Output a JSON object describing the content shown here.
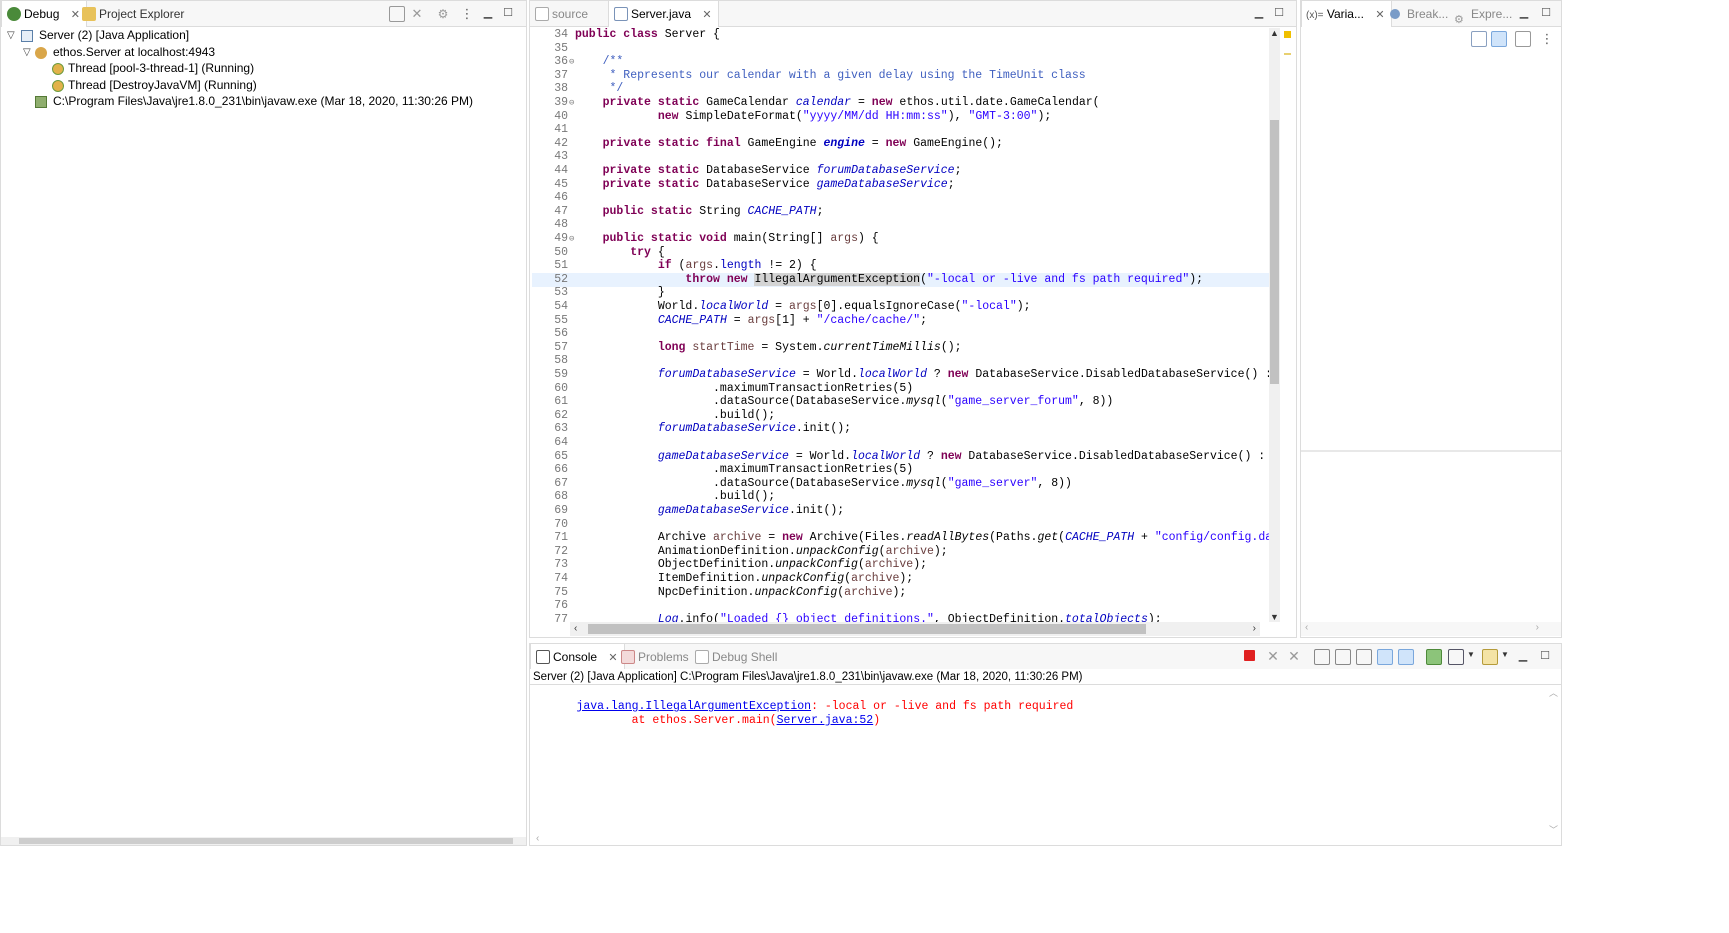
{
  "debug_panel": {
    "tabs": [
      {
        "label": "Debug",
        "active": true,
        "closable": true
      },
      {
        "label": "Project Explorer",
        "active": false,
        "closable": false
      }
    ],
    "tree": [
      {
        "label": "Server (2) [Java Application]",
        "depth": 0,
        "expanded": true,
        "icon": "java-app-icon"
      },
      {
        "label": "ethos.Server at localhost:4943",
        "depth": 1,
        "expanded": true,
        "icon": "vm-icon"
      },
      {
        "label": "Thread [pool-3-thread-1] (Running)",
        "depth": 2,
        "icon": "thread-icon"
      },
      {
        "label": "Thread [DestroyJavaVM] (Running)",
        "depth": 2,
        "icon": "thread-icon"
      },
      {
        "label": "C:\\Program Files\\Java\\jre1.8.0_231\\bin\\javaw.exe (Mar 18, 2020, 11:30:26 PM)",
        "depth": 1,
        "icon": "process-icon"
      }
    ]
  },
  "editor": {
    "tabs": [
      {
        "label": "source",
        "active": false
      },
      {
        "label": "Server.java",
        "active": true,
        "closable": true
      }
    ],
    "highlighted_line": 52,
    "lines": [
      {
        "n": "34",
        "fold": "",
        "html": "<span class=\"kw\">public class</span> Server {"
      },
      {
        "n": "35",
        "fold": "",
        "html": ""
      },
      {
        "n": "36",
        "fold": "⊖",
        "html": "    <span class=\"cm\">/**</span>"
      },
      {
        "n": "37",
        "fold": "",
        "html": "<span class=\"cm\">     * Represents our calendar with a given delay using the TimeUnit class</span>"
      },
      {
        "n": "38",
        "fold": "",
        "html": "<span class=\"cm\">     */</span>"
      },
      {
        "n": "39",
        "fold": "⊖",
        "html": "    <span class=\"kw\">private static</span> GameCalendar <span class=\"fld\">calendar</span> = <span class=\"kw\">new</span> ethos.util.date.GameCalendar("
      },
      {
        "n": "40",
        "fold": "",
        "html": "            <span class=\"kw\">new</span> SimpleDateFormat(<span class=\"str\">\"yyyy/MM/dd HH:mm:ss\"</span>), <span class=\"str\">\"GMT-3:00\"</span>);"
      },
      {
        "n": "41",
        "fold": "",
        "html": ""
      },
      {
        "n": "42",
        "fold": "",
        "html": "    <span class=\"kw\">private static final</span> GameEngine <span class=\"fld\" style=\"font-weight:bold\">engine</span> = <span class=\"kw\">new</span> GameEngine();"
      },
      {
        "n": "43",
        "fold": "",
        "html": ""
      },
      {
        "n": "44",
        "fold": "",
        "html": "    <span class=\"kw\">private static</span> DatabaseService <span class=\"fld\">forumDatabaseService</span>;"
      },
      {
        "n": "45",
        "fold": "",
        "html": "    <span class=\"kw\">private static</span> DatabaseService <span class=\"fld\">gameDatabaseService</span>;"
      },
      {
        "n": "46",
        "fold": "",
        "html": ""
      },
      {
        "n": "47",
        "fold": "",
        "html": "    <span class=\"kw\">public static</span> String <span class=\"fld\">CACHE_PATH</span>;"
      },
      {
        "n": "48",
        "fold": "",
        "html": ""
      },
      {
        "n": "49",
        "fold": "⊖",
        "html": "    <span class=\"kw\">public static void</span> main(String[] <span class=\"var\">args</span>) {"
      },
      {
        "n": "50",
        "fold": "",
        "html": "        <span class=\"kw\">try</span> {"
      },
      {
        "n": "51",
        "fold": "",
        "html": "            <span class=\"kw\">if</span> (<span class=\"var\">args</span>.<span class=\"fld\" style=\"font-style:normal\">length</span> != 2) {"
      },
      {
        "n": "52",
        "fold": "",
        "html": "                <span class=\"kw\">throw new</span> <span class=\"mark\">IllegalArgumentException</span>(<span class=\"str\">\"-local or -live and fs path required\"</span>);"
      },
      {
        "n": "53",
        "fold": "",
        "html": "            }"
      },
      {
        "n": "54",
        "fold": "",
        "html": "            World.<span class=\"fld\">localWorld</span> = <span class=\"var\">args</span>[0].equalsIgnoreCase(<span class=\"str\">\"-local\"</span>);"
      },
      {
        "n": "55",
        "fold": "",
        "html": "            <span class=\"fld\">CACHE_PATH</span> = <span class=\"var\">args</span>[1] + <span class=\"str\">\"/cache/cache/\"</span>;"
      },
      {
        "n": "56",
        "fold": "",
        "html": ""
      },
      {
        "n": "57",
        "fold": "",
        "html": "            <span class=\"kw\">long</span> <span class=\"var\">startTime</span> = System.<span class=\"ital\">currentTimeMillis</span>();"
      },
      {
        "n": "58",
        "fold": "",
        "html": ""
      },
      {
        "n": "59",
        "fold": "",
        "html": "            <span class=\"fld\">forumDatabaseService</span> = World.<span class=\"fld\">localWorld</span> ? <span class=\"kw\">new</span> DatabaseService.DisabledDatabaseService() : <span class=\"kw\">new</span> Data"
      },
      {
        "n": "60",
        "fold": "",
        "html": "                    .maximumTransactionRetries(5)"
      },
      {
        "n": "61",
        "fold": "",
        "html": "                    .dataSource(DatabaseService.<span class=\"ital\">mysql</span>(<span class=\"str\">\"game_server_forum\"</span>, 8))"
      },
      {
        "n": "62",
        "fold": "",
        "html": "                    .build();"
      },
      {
        "n": "63",
        "fold": "",
        "html": "            <span class=\"fld\">forumDatabaseService</span>.init();"
      },
      {
        "n": "64",
        "fold": "",
        "html": ""
      },
      {
        "n": "65",
        "fold": "",
        "html": "            <span class=\"fld\">gameDatabaseService</span> = World.<span class=\"fld\">localWorld</span> ? <span class=\"kw\">new</span> DatabaseService.DisabledDatabaseService() : <span class=\"kw\">new</span> Datal"
      },
      {
        "n": "66",
        "fold": "",
        "html": "                    .maximumTransactionRetries(5)"
      },
      {
        "n": "67",
        "fold": "",
        "html": "                    .dataSource(DatabaseService.<span class=\"ital\">mysql</span>(<span class=\"str\">\"game_server\"</span>, 8))"
      },
      {
        "n": "68",
        "fold": "",
        "html": "                    .build();"
      },
      {
        "n": "69",
        "fold": "",
        "html": "            <span class=\"fld\">gameDatabaseService</span>.init();"
      },
      {
        "n": "70",
        "fold": "",
        "html": ""
      },
      {
        "n": "71",
        "fold": "",
        "html": "            Archive <span class=\"var\">archive</span> = <span class=\"kw\">new</span> Archive(Files.<span class=\"ital\">readAllBytes</span>(Paths.<span class=\"ital\">get</span>(<span class=\"fld\">CACHE_PATH</span> + <span class=\"str\">\"config/config.dat\"</span>)));"
      },
      {
        "n": "72",
        "fold": "",
        "html": "            AnimationDefinition.<span class=\"ital\">unpackConfig</span>(<span class=\"var\">archive</span>);"
      },
      {
        "n": "73",
        "fold": "",
        "html": "            ObjectDefinition.<span class=\"ital\">unpackConfig</span>(<span class=\"var\">archive</span>);"
      },
      {
        "n": "74",
        "fold": "",
        "html": "            ItemDefinition.<span class=\"ital\">unpackConfig</span>(<span class=\"var\">archive</span>);"
      },
      {
        "n": "75",
        "fold": "",
        "html": "            NpcDefinition.<span class=\"ital\">unpackConfig</span>(<span class=\"var\">archive</span>);"
      },
      {
        "n": "76",
        "fold": "",
        "html": ""
      },
      {
        "n": "77",
        "fold": "",
        "html": "            <span class=\"fld\">Log</span>.info(<span class=\"str\">\"Loaded {} object definitions.\"</span>, ObjectDefinition.<span class=\"fld\">totalObjects</span>);"
      }
    ]
  },
  "right_panel": {
    "tabs": [
      {
        "label": "Varia...",
        "active": true,
        "closable": true,
        "prefix": "(x)="
      },
      {
        "label": "Break...",
        "active": false
      },
      {
        "label": "Expre...",
        "active": false
      }
    ]
  },
  "console_panel": {
    "tabs": [
      {
        "label": "Console",
        "active": true,
        "closable": true
      },
      {
        "label": "Problems",
        "active": false
      },
      {
        "label": "Debug Shell",
        "active": false
      }
    ],
    "header": "Server (2) [Java Application] C:\\Program Files\\Java\\jre1.8.0_231\\bin\\javaw.exe (Mar 18, 2020, 11:30:26 PM)",
    "exception_class": "java.lang.IllegalArgumentException",
    "exception_message": ": -local or -live and fs path required",
    "trace_prefix": "        at ethos.Server.main(",
    "trace_link": "Server.java:52",
    "trace_suffix": ")",
    "colors": {
      "error": "#ff0000",
      "link": "#0000ee",
      "terminate": "#e02020"
    }
  }
}
